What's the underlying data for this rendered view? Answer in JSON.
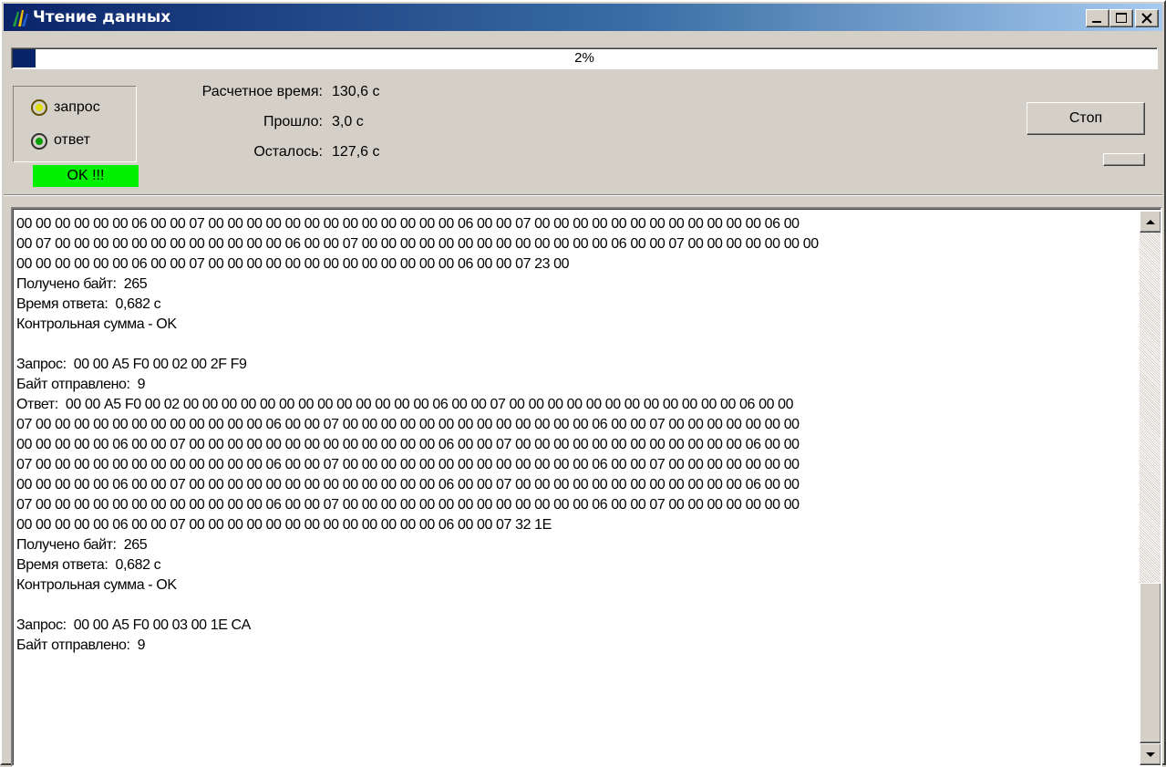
{
  "window": {
    "title": "Чтение данных",
    "controls": [
      "minimize-icon",
      "maximize-icon",
      "close-icon"
    ]
  },
  "progress": {
    "percent": 2,
    "label": "2%"
  },
  "status": {
    "request_label": "запрос",
    "response_label": "ответ",
    "request_led_color": "#e0e000",
    "response_led_color": "#00a000",
    "ok_text": "OK !!!",
    "ok_color": "#00f000"
  },
  "timing": {
    "estimated_label": "Расчетное время:",
    "estimated_value": "130,6 с",
    "elapsed_label": "Прошло:",
    "elapsed_value": "3,0 с",
    "remaining_label": "Осталось:",
    "remaining_value": "127,6 с"
  },
  "buttons": {
    "stop_label": "Стоп"
  },
  "log": {
    "lines": [
      "00 00 00 00 00 00 06 00 00 07 00 00 00 00 00 00 00 00 00 00 00 00 00 06 00 00 07 00 00 00 00 00 00 00 00 00 00 00 00 06 00",
      "00 07 00 00 00 00 00 00 00 00 00 00 00 00 06 00 00 07 00 00 00 00 00 00 00 00 00 00 00 00 00 06 00 00 07 00 00 00 00 00 00 00",
      "00 00 00 00 00 00 06 00 00 07 00 00 00 00 00 00 00 00 00 00 00 00 00 06 00 00 07 23 00",
      "Получено байт:  265",
      "Время ответа:  0,682 с",
      "Контрольная сумма - OK",
      "",
      "Запрос:  00 00 A5 F0 00 02 00 2F F9",
      "Байт отправлено:  9",
      "Ответ:  00 00 A5 F0 00 02 00 00 00 00 00 00 00 00 00 00 00 00 00 06 00 00 07 00 00 00 00 00 00 00 00 00 00 00 00 06 00 00",
      "07 00 00 00 00 00 00 00 00 00 00 00 00 06 00 00 07 00 00 00 00 00 00 00 00 00 00 00 00 00 06 00 00 07 00 00 00 00 00 00 00",
      "00 00 00 00 00 06 00 00 07 00 00 00 00 00 00 00 00 00 00 00 00 00 06 00 00 07 00 00 00 00 00 00 00 00 00 00 00 00 06 00 00",
      "07 00 00 00 00 00 00 00 00 00 00 00 00 06 00 00 07 00 00 00 00 00 00 00 00 00 00 00 00 00 06 00 00 07 00 00 00 00 00 00 00",
      "00 00 00 00 00 06 00 00 07 00 00 00 00 00 00 00 00 00 00 00 00 00 06 00 00 07 00 00 00 00 00 00 00 00 00 00 00 00 06 00 00",
      "07 00 00 00 00 00 00 00 00 00 00 00 00 06 00 00 07 00 00 00 00 00 00 00 00 00 00 00 00 00 06 00 00 07 00 00 00 00 00 00 00",
      "00 00 00 00 00 06 00 00 07 00 00 00 00 00 00 00 00 00 00 00 00 00 06 00 00 07 32 1E",
      "Получено байт:  265",
      "Время ответа:  0,682 с",
      "Контрольная сумма - OK",
      "",
      "Запрос:  00 00 A5 F0 00 03 00 1E CA",
      "Байт отправлено:  9"
    ]
  },
  "scrollbar": {
    "up_icon": "arrow-up-icon",
    "down_icon": "arrow-down-icon"
  }
}
